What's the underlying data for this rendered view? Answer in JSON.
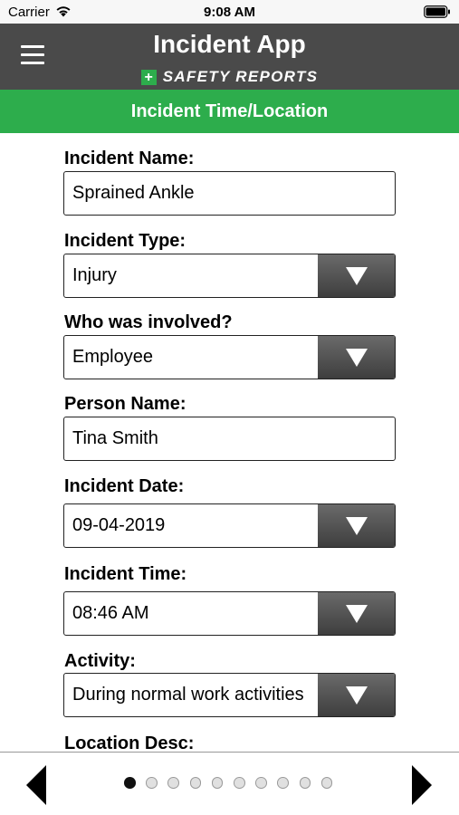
{
  "status_bar": {
    "carrier": "Carrier",
    "time": "9:08 AM",
    "wifi_icon": "wifi-icon",
    "battery_icon": "battery-icon"
  },
  "header": {
    "title": "Incident App",
    "subtitle": "SAFETY REPORTS",
    "plus_symbol": "+",
    "menu_icon": "hamburger-menu-icon",
    "background": "#4a4a4a",
    "accent": "#2dad4c"
  },
  "section": {
    "title": "Incident Time/Location"
  },
  "form": {
    "incident_name": {
      "label": "Incident Name:",
      "value": "Sprained Ankle"
    },
    "incident_type": {
      "label": "Incident Type:",
      "value": "Injury"
    },
    "who_involved": {
      "label": "Who was involved?",
      "value": "Employee"
    },
    "person_name": {
      "label": "Person Name:",
      "value": "Tina Smith"
    },
    "incident_date": {
      "label": "Incident Date:",
      "value": "09-04-2019"
    },
    "incident_time": {
      "label": "Incident Time:",
      "value": "08:46 AM"
    },
    "activity": {
      "label": "Activity:",
      "value": "During normal work activities"
    },
    "location_desc": {
      "label": "Location Desc:"
    }
  },
  "pagination": {
    "total_pages": 10,
    "current_page": 1,
    "prev_icon": "chevron-left-icon",
    "next_icon": "chevron-right-icon"
  }
}
